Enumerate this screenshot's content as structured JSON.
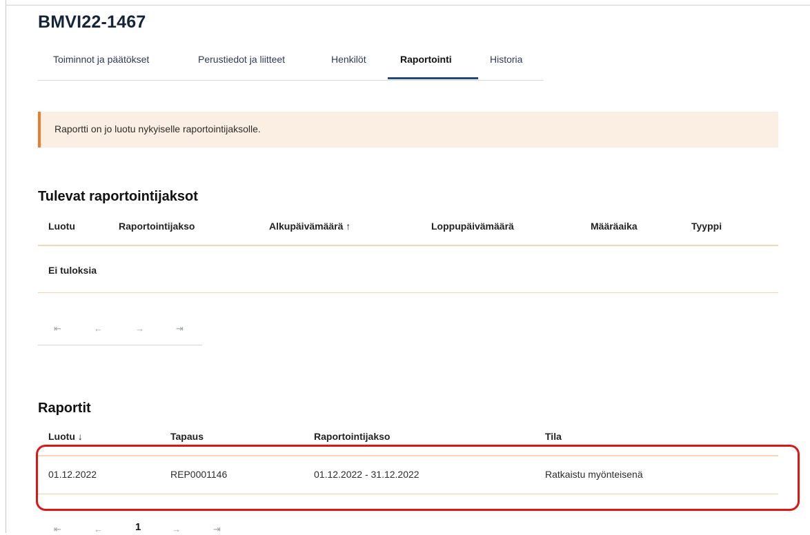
{
  "case_id": "BMVI22-1467",
  "tabs": [
    {
      "label": "Toiminnot ja päätökset"
    },
    {
      "label": "Perustiedot ja liitteet"
    },
    {
      "label": "Henkilöt"
    },
    {
      "label": "Raportointi"
    },
    {
      "label": "Historia"
    }
  ],
  "active_tab": "Raportointi",
  "alert": {
    "text": "Raportti on jo luotu nykyiselle raportointijaksolle."
  },
  "upcoming": {
    "title": "Tulevat raportointijaksot",
    "columns": [
      "Luotu",
      "Raportointijakso",
      "Alkupäivämäärä ↑",
      "Loppupäivämäärä",
      "Määräaika",
      "Tyyppi"
    ],
    "empty_text": "Ei tuloksia",
    "pager": {
      "first": "⇤",
      "prev": "←",
      "next": "→",
      "last": "⇥"
    }
  },
  "reports": {
    "title": "Raportit",
    "columns": [
      "Luotu ↓",
      "Tapaus",
      "Raportointijakso",
      "Tila"
    ],
    "rows": [
      {
        "created": "01.12.2022",
        "case": "REP0001146",
        "period": "01.12.2022 - 31.12.2022",
        "status": "Ratkaistu myönteisenä"
      }
    ],
    "pager": {
      "first": "⇤",
      "prev": "←",
      "page": "1",
      "next": "→",
      "last": "⇥"
    }
  },
  "colors": {
    "accent": "#1f4a7a",
    "alert_bg": "#fbefe3",
    "alert_border": "#ef7d2a",
    "highlight": "#e11414",
    "divider": "#f7d2b3"
  }
}
